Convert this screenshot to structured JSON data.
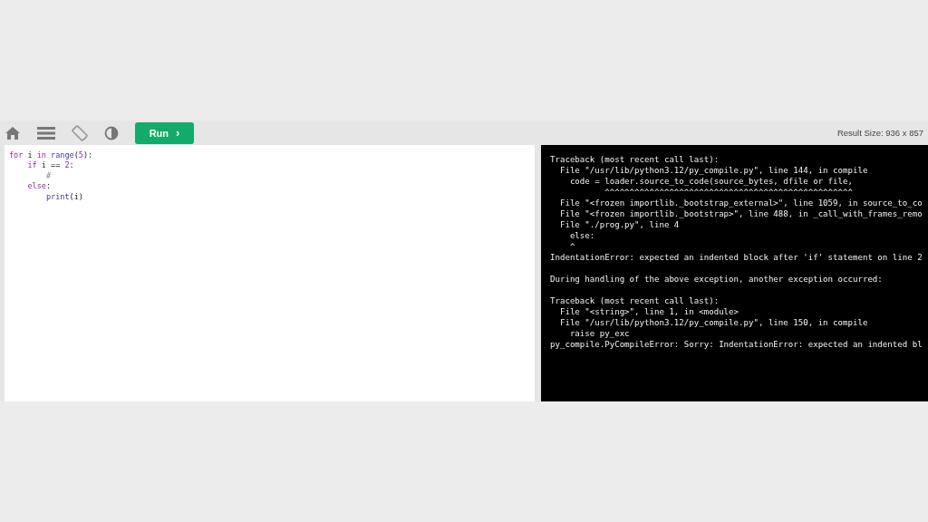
{
  "toolbar": {
    "run_button": {
      "label": "Run",
      "chevron": "›"
    },
    "result_size": "Result Size: 936 x 857"
  },
  "editor": {
    "lines": [
      {
        "tokens": [
          {
            "kind": "keyword",
            "text": "for"
          },
          {
            "kind": "plain",
            "text": " i "
          },
          {
            "kind": "keyword",
            "text": "in"
          },
          {
            "kind": "builtin",
            "text": " range"
          },
          {
            "kind": "plain",
            "text": "("
          },
          {
            "kind": "number",
            "text": "5"
          },
          {
            "kind": "plain",
            "text": "):"
          }
        ]
      },
      {
        "tokens": [
          {
            "kind": "keyword",
            "text": "    if"
          },
          {
            "kind": "plain",
            "text": " i == "
          },
          {
            "kind": "number",
            "text": "2"
          },
          {
            "kind": "plain",
            "text": ":"
          }
        ]
      },
      {
        "tokens": [
          {
            "kind": "comment",
            "text": "        #"
          }
        ]
      },
      {
        "tokens": [
          {
            "kind": "keyword",
            "text": "    else"
          },
          {
            "kind": "plain",
            "text": ":"
          }
        ]
      },
      {
        "tokens": [
          {
            "kind": "builtin",
            "text": "        print"
          },
          {
            "kind": "plain",
            "text": "(i)"
          }
        ]
      }
    ]
  },
  "output": {
    "blocks": [
      [
        "Traceback (most recent call last):",
        "  File \"/usr/lib/python3.12/py_compile.py\", line 144, in compile",
        "    code = loader.source_to_code(source_bytes, dfile or file,",
        "           ^^^^^^^^^^^^^^^^^^^^^^^^^^^^^^^^^^^^^^^^^^^^^^^^^^",
        "  File \"<frozen importlib._bootstrap_external>\", line 1059, in source_to_co",
        "  File \"<frozen importlib._bootstrap>\", line 488, in _call_with_frames_remo",
        "  File \"./prog.py\", line 4",
        "    else:",
        "    ^",
        "IndentationError: expected an indented block after 'if' statement on line 2"
      ],
      [
        "During handling of the above exception, another exception occurred:"
      ],
      [
        "Traceback (most recent call last):",
        "  File \"<string>\", line 1, in <module>",
        "  File \"/usr/lib/python3.12/py_compile.py\", line 150, in compile",
        "    raise py_exc",
        "py_compile.PyCompileError: Sorry: IndentationError: expected an indented bl"
      ]
    ]
  }
}
